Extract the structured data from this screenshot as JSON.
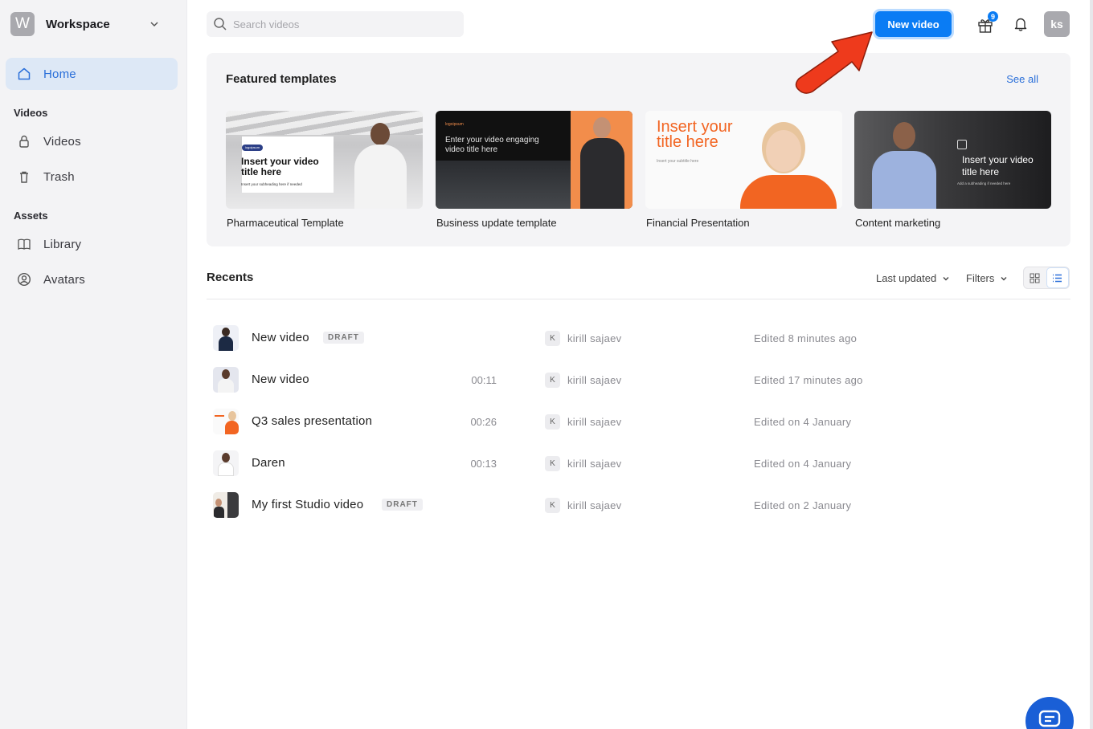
{
  "workspace": {
    "initial": "W",
    "name": "Workspace"
  },
  "sidebar": {
    "home": "Home",
    "sections": [
      {
        "title": "Videos",
        "items": [
          "Videos",
          "Trash"
        ]
      },
      {
        "title": "Assets",
        "items": [
          "Library",
          "Avatars"
        ]
      }
    ]
  },
  "search": {
    "placeholder": "Search videos"
  },
  "header": {
    "new_video": "New video",
    "gift_badge": "9",
    "avatar_initials": "ks"
  },
  "featured": {
    "title": "Featured templates",
    "see_all": "See all",
    "cards": [
      {
        "label": "Pharmaceutical Template",
        "thumb_title": "Insert your video title here",
        "thumb_sub": "Insert your subheading here if needed",
        "thumb_logo": "logoipsum"
      },
      {
        "label": "Business update template",
        "thumb_title": "Enter your video engaging video title here",
        "thumb_logo": "logoipsum"
      },
      {
        "label": "Financial Presentation",
        "thumb_title": "Insert your title here",
        "thumb_sub": "Insert your subtitle here"
      },
      {
        "label": "Content marketing",
        "thumb_title": "Insert your video title here",
        "thumb_sub": "Add a subheading if needed here"
      }
    ]
  },
  "recents": {
    "title": "Recents",
    "sort_label": "Last updated",
    "filters_label": "Filters",
    "view": "list",
    "rows": [
      {
        "name": "New video",
        "badge": "DRAFT",
        "duration": "",
        "owner_initial": "K",
        "owner": "kirill sajaev",
        "edited": "Edited 8 minutes ago"
      },
      {
        "name": "New video",
        "badge": "",
        "duration": "00:11",
        "owner_initial": "K",
        "owner": "kirill sajaev",
        "edited": "Edited 17 minutes ago"
      },
      {
        "name": "Q3 sales presentation",
        "badge": "",
        "duration": "00:26",
        "owner_initial": "K",
        "owner": "kirill sajaev",
        "edited": "Edited on 4 January"
      },
      {
        "name": "Daren",
        "badge": "",
        "duration": "00:13",
        "owner_initial": "K",
        "owner": "kirill sajaev",
        "edited": "Edited on 4 January"
      },
      {
        "name": "My first Studio video",
        "badge": "DRAFT",
        "duration": "",
        "owner_initial": "K",
        "owner": "kirill sajaev",
        "edited": "Edited on 2 January"
      }
    ]
  },
  "colors": {
    "accent": "#0a7cf4",
    "home_bg": "#dde8f6",
    "sidebar_bg": "#f3f3f5",
    "arrow": "#ee3a1c"
  }
}
